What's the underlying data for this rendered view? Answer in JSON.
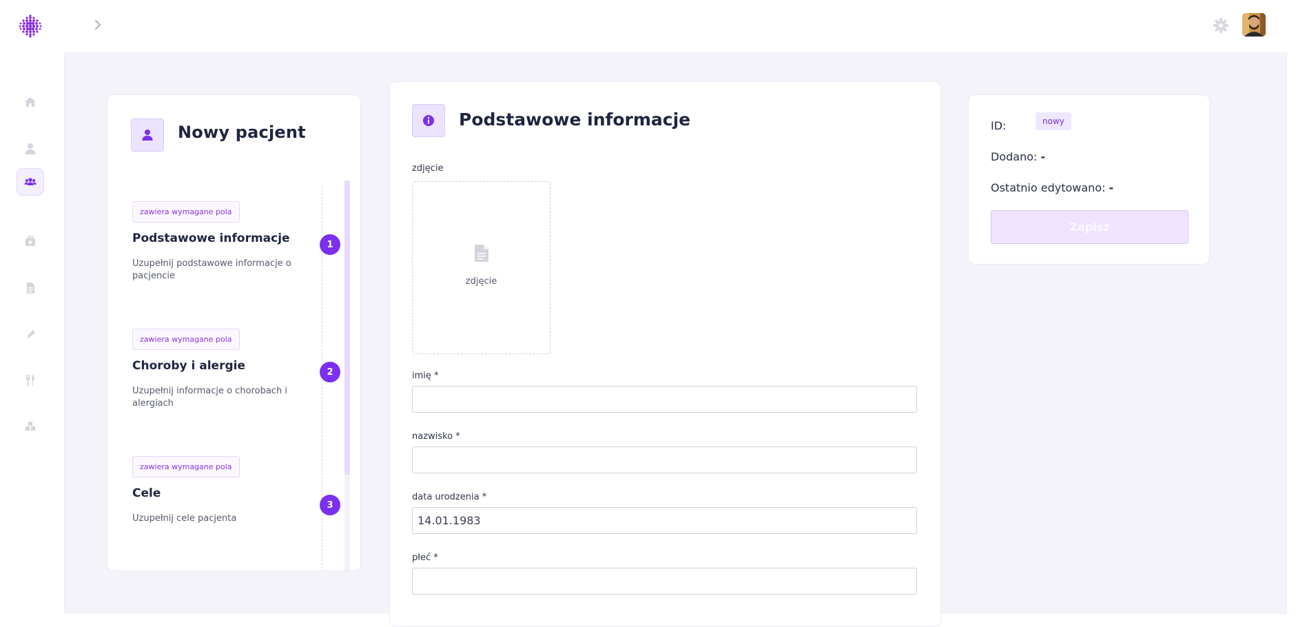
{
  "topbar": {
    "logo_icon": "dotted-sphere-logo",
    "breadcrumb_icon": "chevron-right-icon",
    "settings_icon": "gear-icon",
    "avatar": "user-avatar"
  },
  "sidebar": {
    "items": [
      {
        "icon": "home-icon",
        "active": false
      },
      {
        "icon": "user-icon",
        "active": false
      },
      {
        "icon": "users-icon",
        "active": true
      },
      {
        "icon": "medical-bag-icon",
        "active": false
      },
      {
        "icon": "document-icon",
        "active": false
      },
      {
        "icon": "syringe-icon",
        "active": false
      },
      {
        "icon": "utensils-icon",
        "active": false
      },
      {
        "icon": "cubes-icon",
        "active": false
      }
    ]
  },
  "steps": {
    "title": "Nowy pacjent",
    "icon": "user-icon",
    "items": [
      {
        "badge": "zawiera wymagane pola",
        "title": "Podstawowe informacje",
        "description": "Uzupełnij podstawowe informacje o pacjencie",
        "number": "1"
      },
      {
        "badge": "zawiera wymagane pola",
        "title": "Choroby i alergie",
        "description": "Uzupełnij informacje o chorobach i alergiach",
        "number": "2"
      },
      {
        "badge": "zawiera wymagane pola",
        "title": "Cele",
        "description": "Uzupełnij cele pacjenta",
        "number": "3"
      }
    ]
  },
  "form": {
    "title": "Podstawowe informacje",
    "icon": "info-circle-icon",
    "photo": {
      "label": "zdjęcie",
      "placeholder_text": "zdjęcie",
      "icon": "file-icon"
    },
    "first_name": {
      "label": "imię *",
      "value": ""
    },
    "last_name": {
      "label": "nazwisko *",
      "value": ""
    },
    "birth_date": {
      "label": "data urodzenia *",
      "value": "14.01.1983"
    },
    "gender": {
      "label": "płeć *",
      "value": ""
    }
  },
  "info": {
    "id_label": "ID:",
    "id_value": "nowy",
    "added_label": "Dodano:",
    "added_value": "-",
    "edited_label": "Ostatnio edytowano:",
    "edited_value": "-",
    "save_label": "Zapisz"
  },
  "colors": {
    "accent": "#7b2ff0",
    "accent_light": "#ece3ff",
    "background": "#f5f3fa"
  }
}
